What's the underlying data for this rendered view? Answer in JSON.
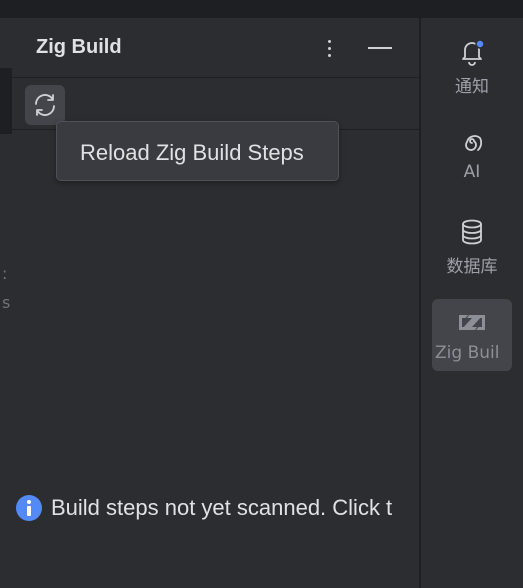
{
  "panel": {
    "title": "Zig Build",
    "options_icon": "kebab-vertical-icon",
    "minimize_icon": "minimize-icon"
  },
  "toolbar": {
    "reload_icon": "refresh-icon"
  },
  "tooltip": {
    "text": "Reload Zig Build Steps"
  },
  "message": {
    "icon": "info-icon",
    "text": "Build steps not yet scanned. Click t"
  },
  "stripe": {
    "items": [
      {
        "label": "通知",
        "icon": "bell-icon",
        "badge": true
      },
      {
        "label": "AI",
        "icon": "ai-spiral-icon"
      },
      {
        "label": "数据库",
        "icon": "database-icon"
      },
      {
        "label": "Zig Buil",
        "icon": "zig-logo-icon",
        "active": true
      }
    ]
  },
  "editor_fragments": [
    ":",
    "s"
  ],
  "colors": {
    "background": "#2b2d30",
    "editor_bg": "#1e1f22",
    "accent": "#548af7",
    "text": "#dfe1e5"
  }
}
